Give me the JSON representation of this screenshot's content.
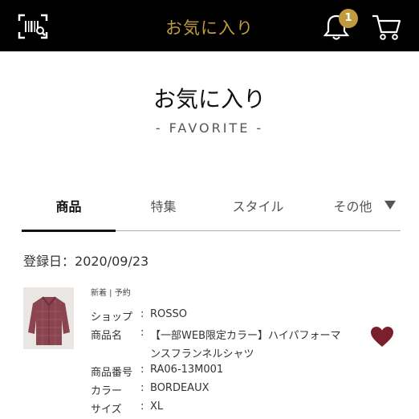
{
  "colors": {
    "header_bg": "#000000",
    "accent_gold": "#c09a3c",
    "heart": "#7a1f2c",
    "text": "#222222"
  },
  "header": {
    "title": "お気に入り",
    "notification_count": "1",
    "icons": {
      "scan": "barcode-scan-icon",
      "bell": "bell-icon",
      "cart": "cart-icon"
    }
  },
  "page": {
    "title": "お気に入り",
    "subtitle": "- FAVORITE -"
  },
  "tabs": [
    {
      "label": "商品"
    },
    {
      "label": "特集"
    },
    {
      "label": "スタイル"
    },
    {
      "label": "その他"
    }
  ],
  "registered": {
    "label": "登録日：",
    "date": "2020/09/23"
  },
  "item": {
    "tags": "新着 | 予約",
    "fields": [
      {
        "label": "ショップ",
        "colon": ":",
        "value": "ROSSO"
      },
      {
        "label": "商品名",
        "colon": ":",
        "value": "【一部WEB限定カラー】ハイパフォーマ"
      },
      {
        "label": "",
        "colon": "",
        "value": "ンスフランネルシャツ"
      },
      {
        "label": "商品番号",
        "colon": ":",
        "value": "RA06-13M001"
      },
      {
        "label": "カラー",
        "colon": ":",
        "value": "BORDEAUX"
      },
      {
        "label": "サイズ",
        "colon": ":",
        "value": "XL"
      }
    ],
    "favorite": true
  }
}
